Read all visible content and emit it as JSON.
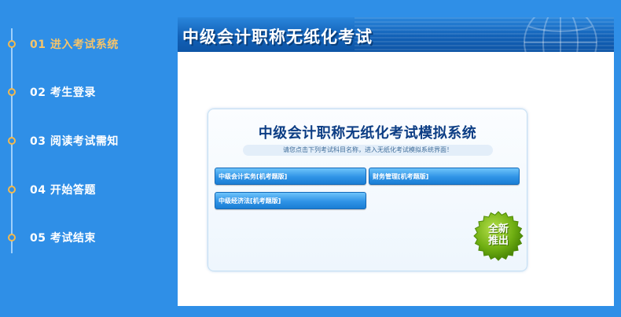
{
  "steps": [
    {
      "label": "01 进入考试系统",
      "active": true
    },
    {
      "label": "02 考生登录"
    },
    {
      "label": "03 阅读考试需知"
    },
    {
      "label": "04 开始答题"
    },
    {
      "label": "05 考试结束"
    }
  ],
  "window": {
    "title": "中级会计职称无纸化考试"
  },
  "card": {
    "title": "中级会计职称无纸化考试模拟系统",
    "subtitle": "请您点击下列考试科目名称，进入无纸化考试模拟系统界面！",
    "subjects": [
      {
        "label": "中级会计实务[机考题版]"
      },
      {
        "label": "财务管理[机考题版]"
      },
      {
        "label": "中级经济法[机考题版]"
      }
    ],
    "badge": {
      "line1": "全新",
      "line2": "推出"
    }
  },
  "colors": {
    "background": "#2f8fe7",
    "active_step": "#f6c46a",
    "step_dot": "#f4b94d",
    "title_navy": "#0c3d84",
    "badge_green": "#5aa000"
  },
  "icons": [
    "step-dot-icon",
    "globe-icon",
    "starburst-badge-icon"
  ]
}
